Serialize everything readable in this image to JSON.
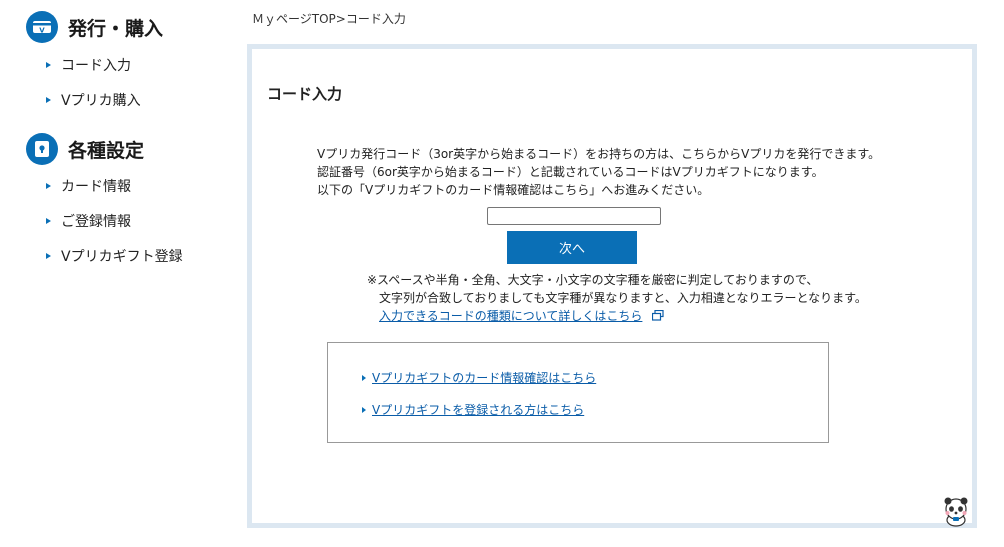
{
  "sidebar": {
    "sections": [
      {
        "title": "発行・購入",
        "icon": "card-v-icon",
        "items": [
          {
            "label": "コード入力"
          },
          {
            "label": "Vプリカ購入"
          }
        ]
      },
      {
        "title": "各種設定",
        "icon": "lock-icon",
        "items": [
          {
            "label": "カード情報"
          },
          {
            "label": "ご登録情報"
          },
          {
            "label": "Vプリカギフト登録"
          }
        ]
      }
    ]
  },
  "breadcrumb": {
    "text": "ＭｙページTOP>コード入力"
  },
  "main": {
    "title": "コード入力",
    "description": [
      "Vプリカ発行コード（3or英字から始まるコード）をお持ちの方は、こちらからVプリカを発行できます。",
      "認証番号（6or英字から始まるコード）と記載されているコードはVプリカギフトになります。",
      "以下の「Vプリカギフトのカード情報確認はこちら」へお進みください。"
    ],
    "code_input": {
      "value": "",
      "placeholder": ""
    },
    "next_button": "次へ",
    "note": [
      "※スペースや半角・全角、大文字・小文字の文字種を厳密に判定しておりますので、",
      "文字列が合致しておりましても文字種が異なりますと、入力相違となりエラーとなります。"
    ],
    "note_link": "入力できるコードの種類について詳しくはこちら",
    "links": [
      {
        "label": "Vプリカギフトのカード情報確認はこちら"
      },
      {
        "label": "Vプリカギフトを登録される方はこちら"
      }
    ]
  },
  "colors": {
    "accent": "#0a6fb6",
    "panel_border": "#dce7f1",
    "link": "#0a5ca8"
  },
  "icons": {
    "external_link": "external-link-icon",
    "mascot": "mascot-icon"
  }
}
